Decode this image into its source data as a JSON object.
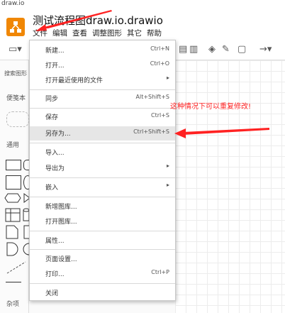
{
  "browser": {
    "url": "draw.io"
  },
  "document": {
    "title": "测试流程图draw.io.drawio"
  },
  "menubar": [
    "文件",
    "编辑",
    "查看",
    "调整图形",
    "其它",
    "帮助"
  ],
  "sidebar": {
    "search_placeholder": "搜索图形",
    "scratchpad": "便笺本",
    "general": "通用",
    "misc": "杂项"
  },
  "file_menu": [
    {
      "label": "新建...",
      "shortcut": "Ctrl+N"
    },
    {
      "label": "打开...",
      "shortcut": "Ctrl+O"
    },
    {
      "label": "打开最近使用的文件",
      "shortcut": "▸"
    },
    {
      "label": "同步",
      "shortcut": "Alt+Shift+S"
    },
    {
      "label": "保存",
      "shortcut": "Ctrl+S"
    },
    {
      "label": "另存为...",
      "shortcut": "Ctrl+Shift+S"
    },
    {
      "label": "导入...",
      "shortcut": ""
    },
    {
      "label": "导出为",
      "shortcut": "▸"
    },
    {
      "label": "嵌入",
      "shortcut": "▸"
    },
    {
      "label": "新增图库...",
      "shortcut": ""
    },
    {
      "label": "打开图库...",
      "shortcut": ""
    },
    {
      "label": "属性...",
      "shortcut": ""
    },
    {
      "label": "页面设置...",
      "shortcut": ""
    },
    {
      "label": "打印...",
      "shortcut": "Ctrl+P"
    },
    {
      "label": "关闭",
      "shortcut": ""
    }
  ],
  "annotation": {
    "text": "这种情况下可以重复修改!"
  },
  "colors": {
    "logo": "#f08705",
    "arrow": "#ff2222",
    "highlight": "#e6e6e6"
  }
}
